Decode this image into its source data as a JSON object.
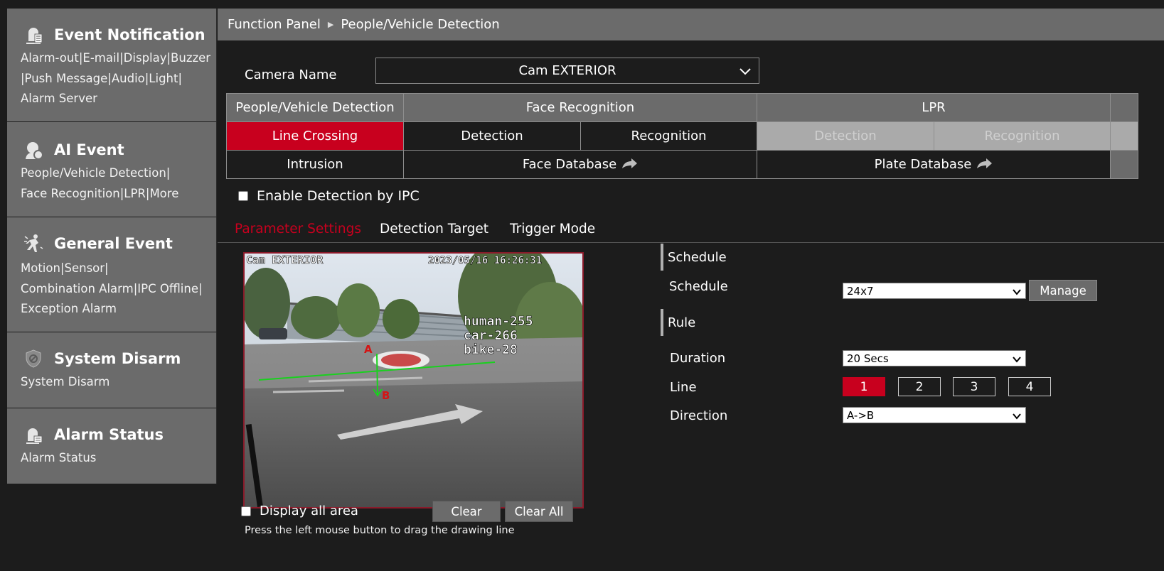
{
  "sidebar": {
    "sections": [
      {
        "title": "Event Notification",
        "icon": "event-notification-icon",
        "links": [
          "Alarm-out|E-mail|Display|Buzzer",
          "|Push Message|Audio|Light|",
          "Alarm Server"
        ]
      },
      {
        "title": "AI Event",
        "icon": "ai-event-icon",
        "links": [
          "People/Vehicle Detection|",
          "Face Recognition|LPR|More"
        ]
      },
      {
        "title": "General Event",
        "icon": "general-event-icon",
        "links": [
          "Motion|Sensor|",
          "Combination Alarm|IPC Offline|",
          "Exception Alarm"
        ]
      },
      {
        "title": "System Disarm",
        "icon": "shield-icon",
        "links": [
          "System Disarm"
        ]
      },
      {
        "title": "Alarm Status",
        "icon": "alarm-status-icon",
        "links": [
          "Alarm Status"
        ]
      }
    ]
  },
  "breadcrumb": {
    "root": "Function Panel",
    "current": "People/Vehicle Detection"
  },
  "camera": {
    "label": "Camera Name",
    "value": "Cam EXTERIOR"
  },
  "tabs": {
    "row1": [
      "People/Vehicle Detection",
      "Face Recognition",
      "LPR"
    ],
    "row2": [
      "Line Crossing",
      "Detection",
      "Recognition",
      "Detection",
      "Recognition"
    ],
    "row3": [
      "Intrusion",
      "Face Database",
      "Plate Database"
    ]
  },
  "enable_ipc": "Enable Detection by IPC",
  "subtabs": [
    "Parameter Settings",
    "Detection Target",
    "Trigger Mode"
  ],
  "video": {
    "camera_name": "Cam EXTERIOR",
    "timestamp": "2023/05/16 16:26:31",
    "counts": [
      "human-255",
      "car-266",
      "bike-28"
    ],
    "point_a": "A",
    "point_b": "B"
  },
  "display_all_area": "Display all area",
  "buttons": {
    "clear": "Clear",
    "clear_all": "Clear All",
    "manage": "Manage"
  },
  "hint": "Press the left mouse button to drag the drawing line",
  "schedule": {
    "section": "Schedule",
    "label": "Schedule",
    "value": "24x7"
  },
  "rule": {
    "section": "Rule",
    "duration_label": "Duration",
    "duration_value": "20 Secs",
    "line_label": "Line",
    "lines": [
      "1",
      "2",
      "3",
      "4"
    ],
    "direction_label": "Direction",
    "direction_value": "A->B"
  },
  "colors": {
    "accent": "#c8001e",
    "panel": "#6b6b6b",
    "background": "#1c1c1c"
  }
}
